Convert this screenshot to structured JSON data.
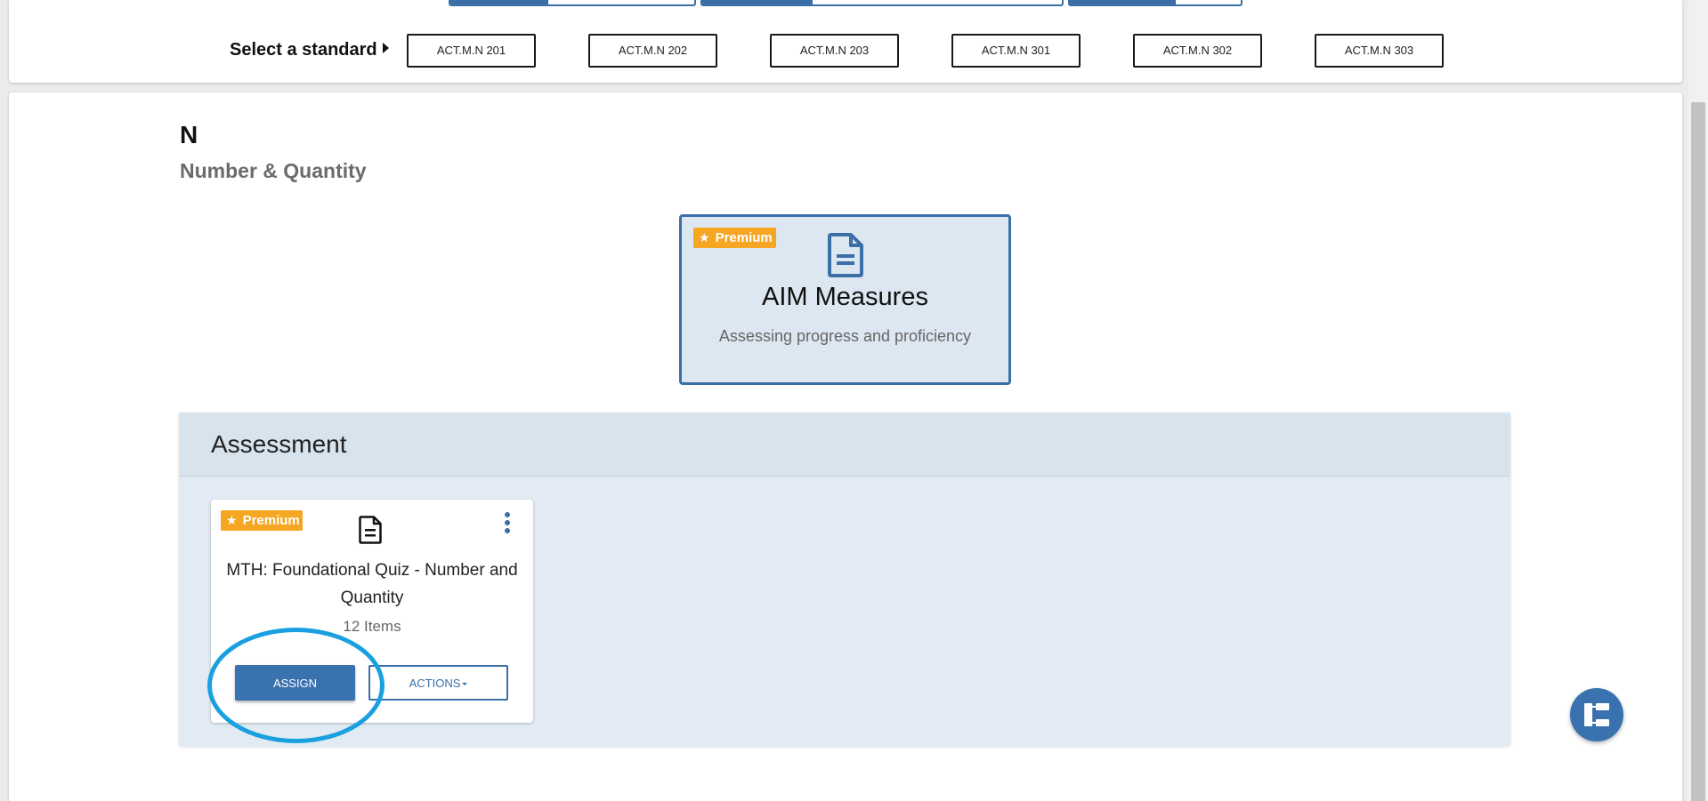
{
  "standard_selector": {
    "label": "Select a standard",
    "standards": [
      "ACT.M.N 201",
      "ACT.M.N 202",
      "ACT.M.N 203",
      "ACT.M.N 301",
      "ACT.M.N 302",
      "ACT.M.N 303"
    ]
  },
  "section": {
    "code": "N",
    "name": "Number & Quantity"
  },
  "aim_card": {
    "badge": "Premium",
    "title": "AIM Measures",
    "description": "Assessing progress and proficiency",
    "icon": "document-icon"
  },
  "assessment": {
    "title": "Assessment",
    "items": [
      {
        "badge": "Premium",
        "title": "MTH: Foundational Quiz - Number and Quantity",
        "count": "12 Items",
        "assign_label": "ASSIGN",
        "actions_label": "ACTIONS"
      }
    ]
  },
  "colors": {
    "primary": "#3a6fa8",
    "badge": "#f5a623",
    "highlight": "#1aa0e0",
    "panel": "#e2ebf4"
  }
}
